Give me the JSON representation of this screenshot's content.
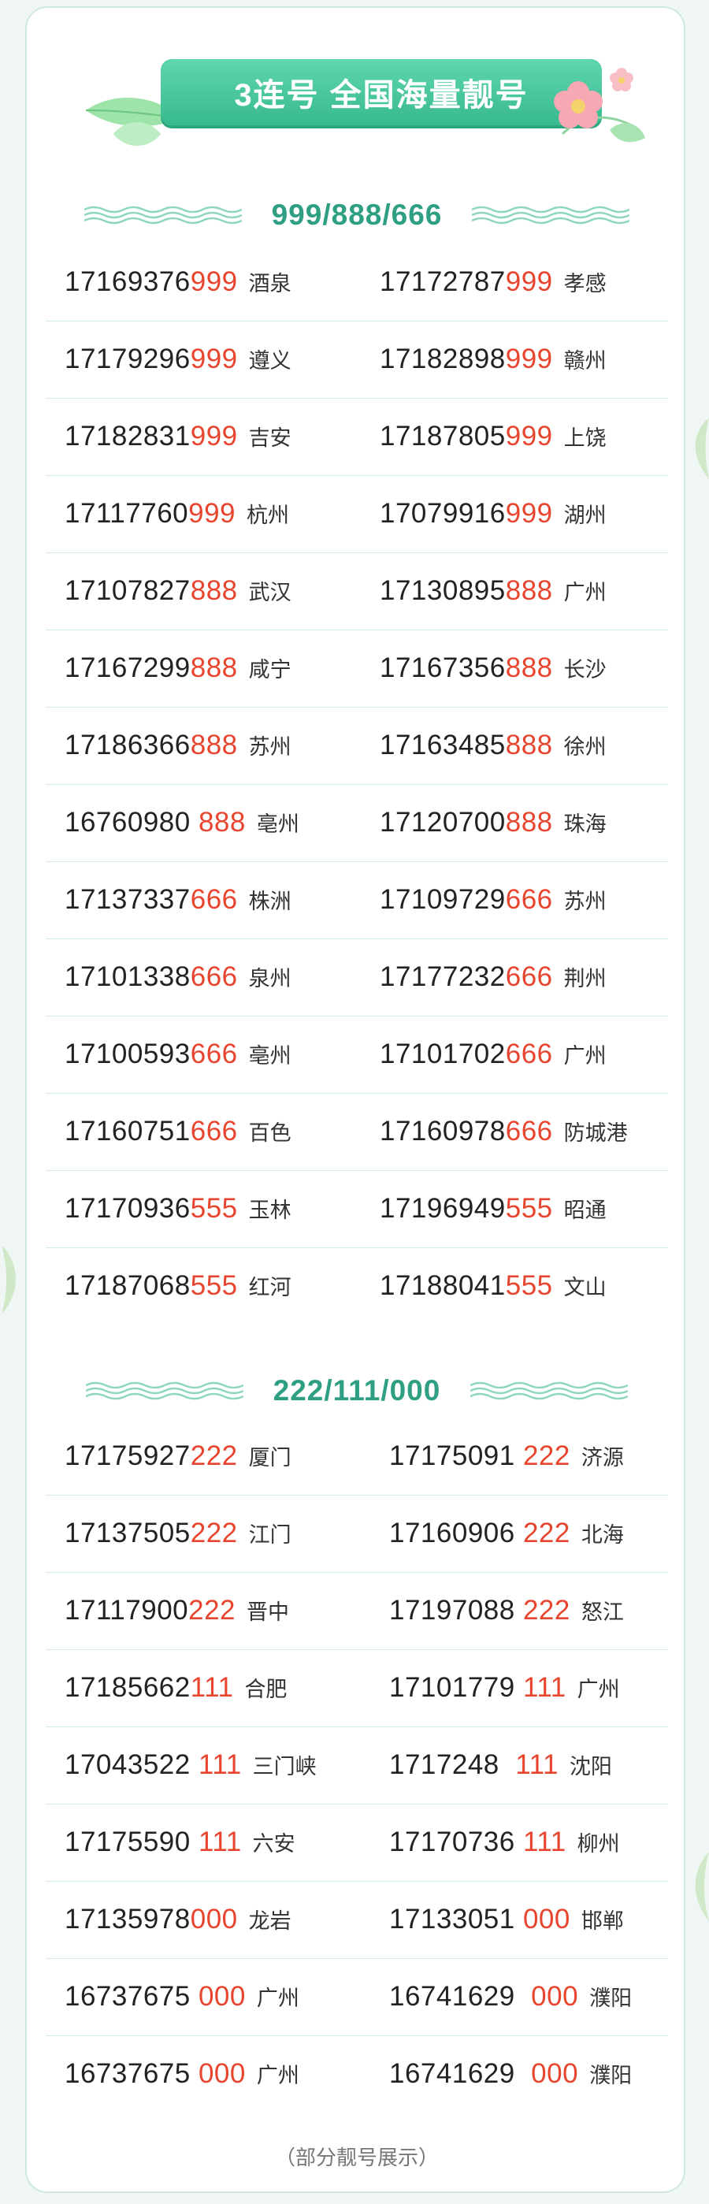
{
  "banner": {
    "title": "3连号  全国海量靓号"
  },
  "sections": [
    {
      "title": "999/888/666",
      "rows": [
        [
          {
            "prefix": "17169376",
            "tail": "999",
            "city": "酒泉"
          },
          {
            "prefix": "17172787",
            "tail": "999",
            "city": "孝感"
          }
        ],
        [
          {
            "prefix": "17179296",
            "tail": "999",
            "city": "遵义"
          },
          {
            "prefix": "17182898",
            "tail": "999",
            "city": "赣州"
          }
        ],
        [
          {
            "prefix": "17182831",
            "tail": "999",
            "city": "吉安"
          },
          {
            "prefix": "17187805",
            "tail": "999",
            "city": "上饶"
          }
        ],
        [
          {
            "prefix": "17117760",
            "tail": "999",
            "city": "杭州"
          },
          {
            "prefix": "17079916",
            "tail": "999",
            "city": "湖州"
          }
        ],
        [
          {
            "prefix": "17107827",
            "tail": "888",
            "city": "武汉"
          },
          {
            "prefix": "17130895",
            "tail": "888",
            "city": "广州"
          }
        ],
        [
          {
            "prefix": "17167299",
            "tail": "888",
            "city": "咸宁"
          },
          {
            "prefix": "17167356",
            "tail": "888",
            "city": "长沙"
          }
        ],
        [
          {
            "prefix": "17186366",
            "tail": "888",
            "city": "苏州"
          },
          {
            "prefix": "17163485",
            "tail": "888",
            "city": "徐州"
          }
        ],
        [
          {
            "prefix": "16760980 ",
            "tail": "888",
            "city": "亳州"
          },
          {
            "prefix": "17120700",
            "tail": "888",
            "city": "珠海"
          }
        ],
        [
          {
            "prefix": "17137337",
            "tail": "666",
            "city": "株洲"
          },
          {
            "prefix": "17109729",
            "tail": "666",
            "city": "苏州"
          }
        ],
        [
          {
            "prefix": "17101338",
            "tail": "666",
            "city": "泉州"
          },
          {
            "prefix": "17177232",
            "tail": "666",
            "city": "荆州"
          }
        ],
        [
          {
            "prefix": "17100593",
            "tail": "666",
            "city": "亳州"
          },
          {
            "prefix": "17101702",
            "tail": "666",
            "city": "广州"
          }
        ],
        [
          {
            "prefix": "17160751",
            "tail": "666",
            "city": "百色"
          },
          {
            "prefix": "17160978",
            "tail": "666",
            "city": "防城港"
          }
        ],
        [
          {
            "prefix": "17170936",
            "tail": "555",
            "city": "玉林"
          },
          {
            "prefix": "17196949",
            "tail": "555",
            "city": "昭通"
          }
        ],
        [
          {
            "prefix": "17187068",
            "tail": "555",
            "city": "红河"
          },
          {
            "prefix": "17188041",
            "tail": "555",
            "city": "文山"
          }
        ]
      ]
    },
    {
      "title": "222/111/000",
      "rows": [
        [
          {
            "prefix": "17175927",
            "tail": "222",
            "city": "厦门"
          },
          {
            "prefix": "17175091 ",
            "tail": "222",
            "city": "济源"
          }
        ],
        [
          {
            "prefix": "17137505",
            "tail": "222",
            "city": "江门"
          },
          {
            "prefix": "17160906 ",
            "tail": "222",
            "city": "北海"
          }
        ],
        [
          {
            "prefix": "17117900",
            "tail": "222",
            "city": "晋中"
          },
          {
            "prefix": "17197088 ",
            "tail": "222",
            "city": "怒江"
          }
        ],
        [
          {
            "prefix": "17185662",
            "tail": "111",
            "city": "合肥"
          },
          {
            "prefix": "17101779 ",
            "tail": "111",
            "city": "广州"
          }
        ],
        [
          {
            "prefix": "17043522 ",
            "tail": "111",
            "city": "三门峡"
          },
          {
            "prefix": "1717248  ",
            "tail": "111",
            "city": "沈阳"
          }
        ],
        [
          {
            "prefix": "17175590 ",
            "tail": "111",
            "city": "六安"
          },
          {
            "prefix": "17170736 ",
            "tail": "111",
            "city": "柳州"
          }
        ],
        [
          {
            "prefix": "17135978",
            "tail": "000",
            "city": "龙岩"
          },
          {
            "prefix": "17133051 ",
            "tail": "000",
            "city": "邯郸"
          }
        ],
        [
          {
            "prefix": "16737675 ",
            "tail": "000",
            "city": "广州"
          },
          {
            "prefix": "16741629  ",
            "tail": "000",
            "city": "濮阳"
          }
        ],
        [
          {
            "prefix": "16737675 ",
            "tail": "000",
            "city": "广州"
          },
          {
            "prefix": "16741629  ",
            "tail": "000",
            "city": "濮阳"
          }
        ]
      ]
    }
  ],
  "footer": "（部分靓号展示）",
  "colors": {
    "accent": "#2f9f84",
    "tail": "#e8452f",
    "banner": "#45c49c",
    "divider": "#d5ede5"
  },
  "icons": [
    "leaf-icon",
    "flower-icon",
    "wave-icon"
  ]
}
